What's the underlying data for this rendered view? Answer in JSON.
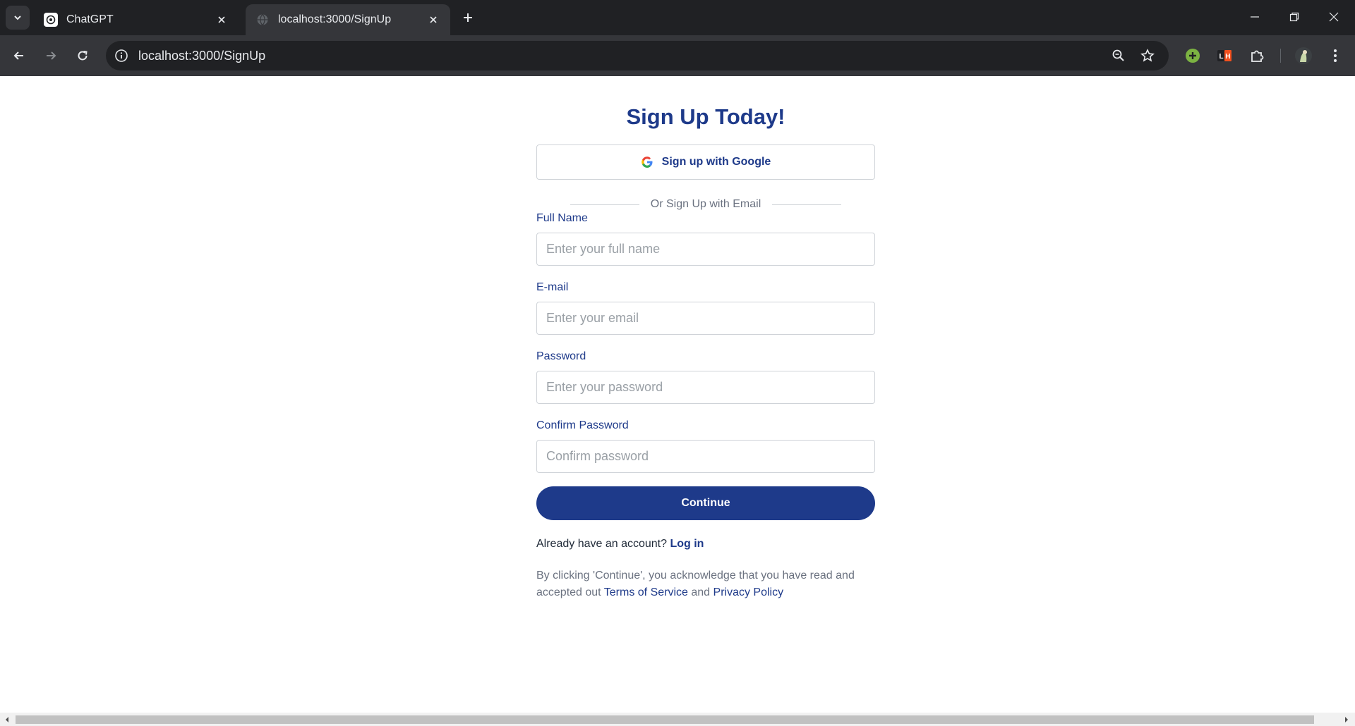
{
  "browser": {
    "tabs": [
      {
        "title": "ChatGPT",
        "icon": "chatgpt-icon",
        "active": false
      },
      {
        "title": "localhost:3000/SignUp",
        "icon": "globe-icon",
        "active": true
      }
    ],
    "url": "localhost:3000/SignUp",
    "colors": {
      "tabbar": "#202124",
      "toolbar": "#35363a",
      "omnibox": "#202124"
    }
  },
  "page": {
    "heading": "Sign Up Today!",
    "google_button": "Sign up with Google",
    "divider_text": "Or Sign Up with Email",
    "fields": {
      "full_name": {
        "label": "Full Name",
        "placeholder": "Enter your full name",
        "value": ""
      },
      "email": {
        "label": "E-mail",
        "placeholder": "Enter your email",
        "value": ""
      },
      "password": {
        "label": "Password",
        "placeholder": "Enter your password",
        "value": ""
      },
      "confirm_password": {
        "label": "Confirm Password",
        "placeholder": "Confirm password",
        "value": ""
      }
    },
    "continue_button": "Continue",
    "already_account": "Already have an account?",
    "login_link": "Log in",
    "legal": {
      "prefix": "By clicking 'Continue', you acknowledge that you have read and accepted out",
      "terms": "Terms of Service",
      "and": "and",
      "privacy": "Privacy Policy"
    },
    "colors": {
      "primary": "#1e3a8a",
      "muted": "#6b7280",
      "border": "#cfd3d8"
    }
  }
}
